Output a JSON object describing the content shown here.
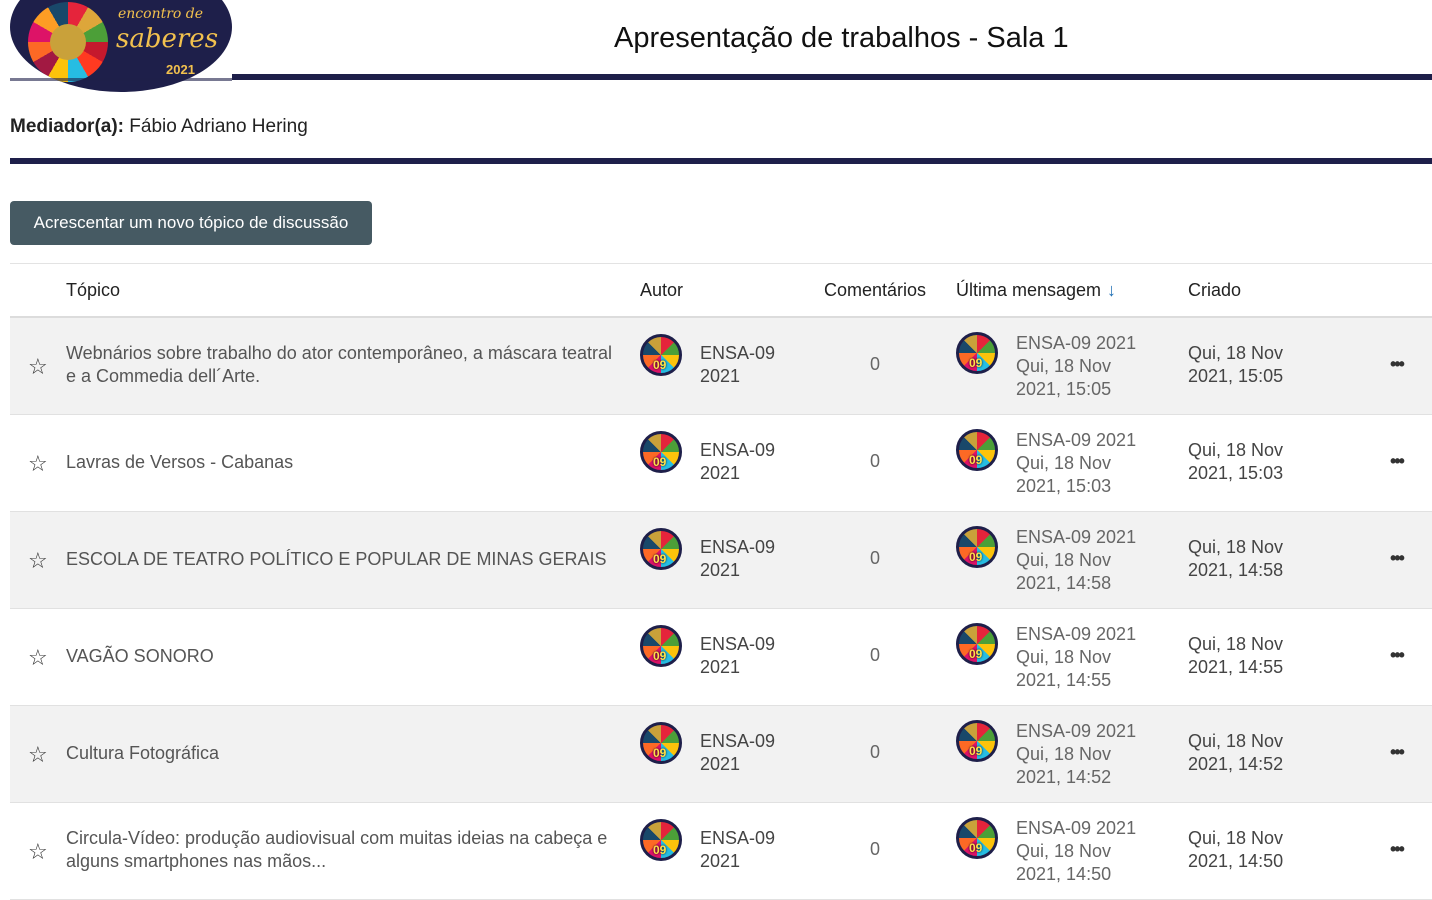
{
  "header": {
    "logo": {
      "line1": "encontro de",
      "line2": "saberes",
      "line3": "2021"
    },
    "title": "Apresentação de trabalhos - Sala 1"
  },
  "mediator": {
    "label": "Mediador(a):",
    "name": "Fábio Adriano Hering"
  },
  "add_button": "Acrescentar um novo tópico de discussão",
  "columns": {
    "topic": "Tópico",
    "author": "Autor",
    "comments": "Comentários",
    "last_message": "Última mensagem",
    "sort_icon": "arrow-down",
    "created": "Criado"
  },
  "avatar_label": "09",
  "rows": [
    {
      "topic": "Webnários sobre trabalho do ator contemporâneo, a máscara teatral e a Commedia dell´Arte.",
      "author_line1": "ENSA-09",
      "author_line2": "2021",
      "comments": "0",
      "last_author": "ENSA-09 2021",
      "last_date1": "Qui, 18 Nov",
      "last_date2": "2021, 15:05",
      "created1": "Qui, 18 Nov",
      "created2": "2021, 15:05"
    },
    {
      "topic": "Lavras de Versos - Cabanas",
      "author_line1": "ENSA-09",
      "author_line2": "2021",
      "comments": "0",
      "last_author": "ENSA-09 2021",
      "last_date1": "Qui, 18 Nov",
      "last_date2": "2021, 15:03",
      "created1": "Qui, 18 Nov",
      "created2": "2021, 15:03"
    },
    {
      "topic": "ESCOLA DE TEATRO POLÍTICO E POPULAR DE MINAS GERAIS",
      "author_line1": "ENSA-09",
      "author_line2": "2021",
      "comments": "0",
      "last_author": "ENSA-09 2021",
      "last_date1": "Qui, 18 Nov",
      "last_date2": "2021, 14:58",
      "created1": "Qui, 18 Nov",
      "created2": "2021, 14:58"
    },
    {
      "topic": "VAGÃO SONORO",
      "author_line1": "ENSA-09",
      "author_line2": "2021",
      "comments": "0",
      "last_author": "ENSA-09 2021",
      "last_date1": "Qui, 18 Nov",
      "last_date2": "2021, 14:55",
      "created1": "Qui, 18 Nov",
      "created2": "2021, 14:55"
    },
    {
      "topic": "Cultura Fotográfica",
      "author_line1": "ENSA-09",
      "author_line2": "2021",
      "comments": "0",
      "last_author": "ENSA-09 2021",
      "last_date1": "Qui, 18 Nov",
      "last_date2": "2021, 14:52",
      "created1": "Qui, 18 Nov",
      "created2": "2021, 14:52"
    },
    {
      "topic": "Circula-Vídeo: produção audiovisual com muitas ideias na cabeça e alguns smartphones nas mãos...",
      "author_line1": "ENSA-09",
      "author_line2": "2021",
      "comments": "0",
      "last_author": "ENSA-09 2021",
      "last_date1": "Qui, 18 Nov",
      "last_date2": "2021, 14:50",
      "created1": "Qui, 18 Nov",
      "created2": "2021, 14:50"
    }
  ]
}
